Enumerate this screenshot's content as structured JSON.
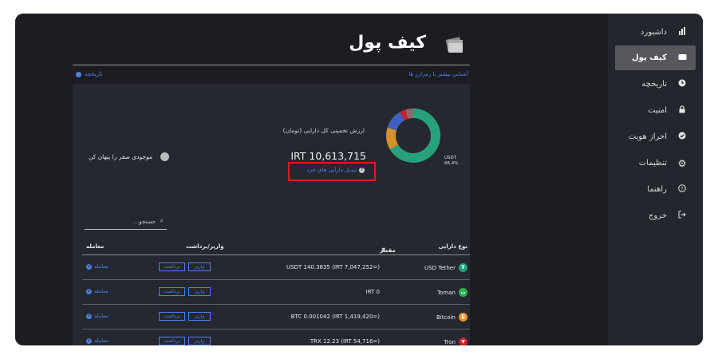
{
  "sidebar": {
    "items": [
      {
        "label": "داشبورد",
        "icon": "chart-icon",
        "glyph": "▮",
        "active": false
      },
      {
        "label": "کیف پول",
        "icon": "wallet-icon",
        "glyph": "▭",
        "active": true
      },
      {
        "label": "تاریخچه",
        "icon": "clock-icon",
        "glyph": "◷",
        "active": false
      },
      {
        "label": "امنیت",
        "icon": "lock-icon",
        "glyph": "🔒",
        "active": false
      },
      {
        "label": "احراز هویت",
        "icon": "badge-check-icon",
        "glyph": "✔",
        "active": false
      },
      {
        "label": "تنظیمات",
        "icon": "gear-icon",
        "glyph": "⚙",
        "active": false
      },
      {
        "label": "راهنما",
        "icon": "help-icon",
        "glyph": "?",
        "active": false
      },
      {
        "label": "خروج",
        "icon": "logout-icon",
        "glyph": "⇥",
        "active": false
      }
    ]
  },
  "header": {
    "title": "کیف پول",
    "learn_more": "آشنایی بیشتر با رمزارز ها",
    "history_link": "تاریخچه"
  },
  "summary": {
    "estimate_label": "ارزش تخمینی کل دارایی (تومان)",
    "total": "IRT 10,613,715",
    "convert_link": "تبدیل دارایی های خرد",
    "chart_label": "USDT",
    "chart_pct": "66.4%"
  },
  "controls": {
    "hide_zero_label": "موجودی صفر را پنهان کن",
    "search_placeholder": "جستجو..."
  },
  "table": {
    "headers": {
      "asset": "نوع دارایی",
      "amount": "مقدار",
      "deposit_withdraw": "واریز/برداشت",
      "trade": "معامله"
    },
    "deposit_label": "واریز",
    "withdraw_label": "برداشت",
    "trade_label": "معامله",
    "rows": [
      {
        "name": "USD Tether",
        "amount": "USDT 140.3835 (IRT 7,047,252=)",
        "coin_color": "#26a17b",
        "glyph": "₮"
      },
      {
        "name": "Toman",
        "amount": "IRT 0",
        "coin_color": "#2bb24c",
        "glyph": "ت"
      },
      {
        "name": "Bitcoin",
        "amount": "BTC 0.001042 (IRT 1,419,420=)",
        "coin_color": "#f7931a",
        "glyph": "₿"
      },
      {
        "name": "Tron",
        "amount": "TRX 12.23 (IRT 54,716=)",
        "coin_color": "#c8232c",
        "glyph": "▼"
      }
    ]
  },
  "colors": {
    "accent": "#4f7fe8",
    "highlight": "#e21b1b",
    "usdt": "#26a17b",
    "btc": "#d4902a",
    "blue_slice": "#3f5fc0",
    "red_slice": "#c8232c"
  }
}
